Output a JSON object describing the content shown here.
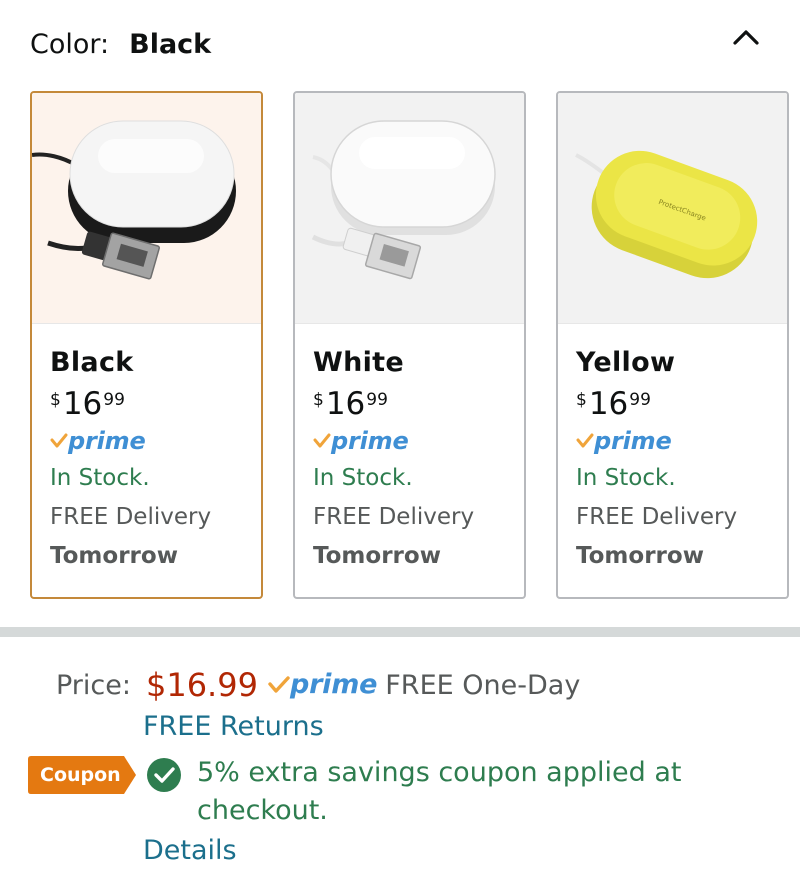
{
  "color_selector": {
    "label": "Color:",
    "selected_value": "Black",
    "collapse_icon": "chevron-up-icon"
  },
  "swatches": [
    {
      "name": "Black",
      "image": "black-wireless-charger-with-usb-cable",
      "price": {
        "currency": "$",
        "whole": "16",
        "fraction": "99"
      },
      "prime": "prime",
      "stock": "In Stock.",
      "delivery": "FREE Delivery",
      "delivery_day": "Tomorrow",
      "selected": true
    },
    {
      "name": "White",
      "image": "white-wireless-charger-with-usb-cable",
      "price": {
        "currency": "$",
        "whole": "16",
        "fraction": "99"
      },
      "prime": "prime",
      "stock": "In Stock.",
      "delivery": "FREE Delivery",
      "delivery_day": "Tomorrow",
      "selected": false
    },
    {
      "name": "Yellow",
      "image": "yellow-wireless-charger",
      "price": {
        "currency": "$",
        "whole": "16",
        "fraction": "99"
      },
      "prime": "prime",
      "stock": "In Stock.",
      "delivery": "FREE Delivery",
      "delivery_day": "Tomorrow",
      "selected": false
    }
  ],
  "price_section": {
    "label": "Price:",
    "value": "$16.99",
    "prime": "prime",
    "shipping": "FREE One-Day",
    "returns_link": "FREE Returns"
  },
  "coupon": {
    "badge": "Coupon",
    "icon": "check-circle-icon",
    "text": "5% extra savings coupon applied at checkout.",
    "details_link": "Details"
  },
  "colors": {
    "price_red": "#b12704",
    "stock_green": "#2e7d4f",
    "link_teal": "#1b6f8c",
    "prime_blue": "#3f8fd4",
    "prime_check_orange": "#f0a43a",
    "coupon_orange": "#e47911",
    "selected_border": "#c4893a"
  }
}
